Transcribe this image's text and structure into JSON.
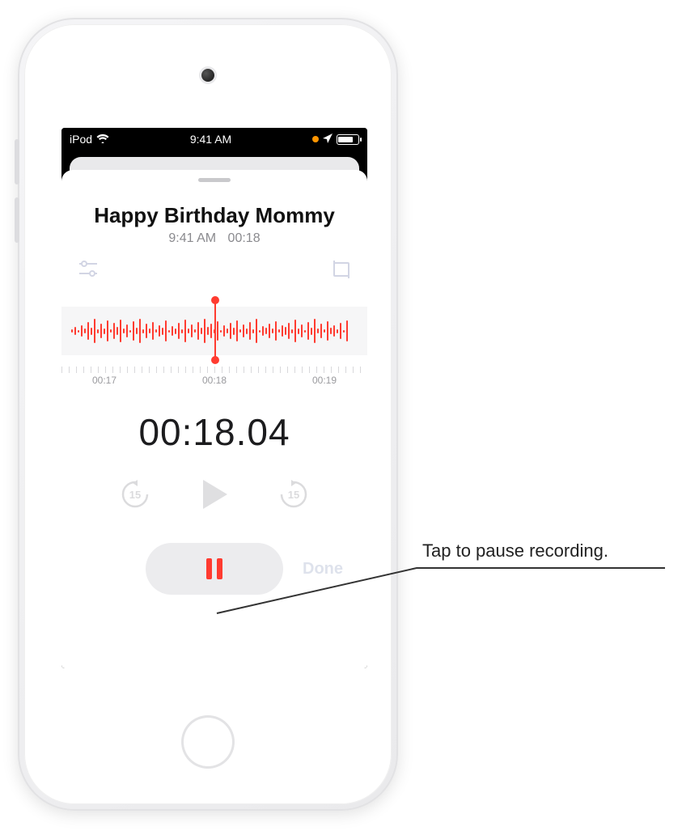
{
  "status_bar": {
    "device_label": "iPod",
    "time": "9:41 AM"
  },
  "recording": {
    "title": "Happy Birthday Mommy",
    "created_time": "9:41 AM",
    "duration": "00:18",
    "elapsed": "00:18.04",
    "ruler": {
      "t0": "00:17",
      "t1": "00:18",
      "t2": "00:19"
    },
    "skip_back_seconds": "15",
    "skip_fwd_seconds": "15",
    "done_label": "Done"
  },
  "callout": {
    "text": "Tap to pause recording."
  },
  "colors": {
    "accent": "#ff3b30",
    "muted": "#9a9a9e"
  },
  "waveform_heights": [
    4,
    10,
    3,
    14,
    6,
    22,
    9,
    30,
    5,
    18,
    7,
    26,
    4,
    20,
    10,
    28,
    6,
    16,
    3,
    24,
    8,
    30,
    5,
    18,
    6,
    22,
    4,
    14,
    9,
    26,
    3,
    12,
    7,
    20,
    5,
    28,
    6,
    16,
    4,
    22,
    8,
    30,
    10,
    18,
    5,
    24,
    3,
    14,
    6,
    20,
    9,
    26,
    4,
    16,
    7,
    22,
    5,
    30,
    3,
    12,
    8,
    18,
    6,
    24,
    4,
    14,
    10,
    20,
    5,
    28,
    7,
    16,
    3,
    22,
    9,
    30,
    6,
    18,
    4,
    24,
    8,
    14,
    5,
    20,
    3,
    26
  ]
}
